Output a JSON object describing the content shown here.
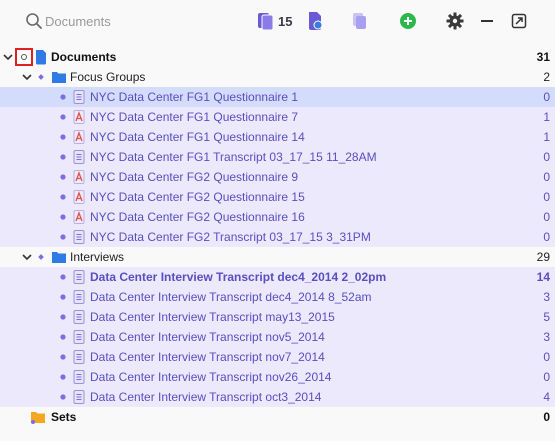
{
  "toolbar": {
    "search_placeholder": "Documents",
    "doc_count": "15"
  },
  "tree": {
    "root": {
      "label": "Documents",
      "count": "31"
    },
    "groups": [
      {
        "label": "Focus Groups",
        "count": "2",
        "items": [
          {
            "label": "NYC Data Center FG1 Questionnaire 1",
            "count": "0",
            "type": "text"
          },
          {
            "label": "NYC Data Center FG1 Questionnaire 7",
            "count": "1",
            "type": "pdf"
          },
          {
            "label": "NYC Data Center FG1 Questionnaire 14",
            "count": "1",
            "type": "pdf"
          },
          {
            "label": "NYC Data Center FG1 Transcript 03_17_15 11_28AM",
            "count": "0",
            "type": "text"
          },
          {
            "label": "NYC Data Center FG2 Questionnaire 9",
            "count": "0",
            "type": "pdf"
          },
          {
            "label": "NYC Data Center FG2 Questionnaire 15",
            "count": "0",
            "type": "pdf"
          },
          {
            "label": "NYC Data Center FG2 Questionnaire 16",
            "count": "0",
            "type": "pdf"
          },
          {
            "label": "NYC Data Center FG2 Transcript 03_17_15 3_31PM",
            "count": "0",
            "type": "text"
          }
        ]
      },
      {
        "label": "Interviews",
        "count": "29",
        "items": [
          {
            "label": "Data Center Interview Transcript dec4_2014 2_02pm",
            "count": "14",
            "type": "text"
          },
          {
            "label": "Data Center Interview Transcript dec4_2014 8_52am",
            "count": "3",
            "type": "text"
          },
          {
            "label": "Data Center Interview Transcript may13_2015",
            "count": "5",
            "type": "text"
          },
          {
            "label": "Data Center Interview Transcript nov5_2014",
            "count": "3",
            "type": "text"
          },
          {
            "label": "Data Center Interview Transcript nov7_2014",
            "count": "0",
            "type": "text"
          },
          {
            "label": "Data Center Interview Transcript nov26_2014",
            "count": "0",
            "type": "text"
          },
          {
            "label": "Data Center Interview Transcript oct3_2014",
            "count": "4",
            "type": "text"
          }
        ]
      }
    ],
    "sets": {
      "label": "Sets",
      "count": "0"
    }
  },
  "colors": {
    "accent": "#5a4ec0",
    "selection": "#d4dcfb",
    "group_highlight": "#ebe9fb",
    "folder_blue": "#2e7be6",
    "pdf_red": "#e0504a",
    "add_green": "#2cb84a",
    "sets_orange": "#f5a623"
  }
}
